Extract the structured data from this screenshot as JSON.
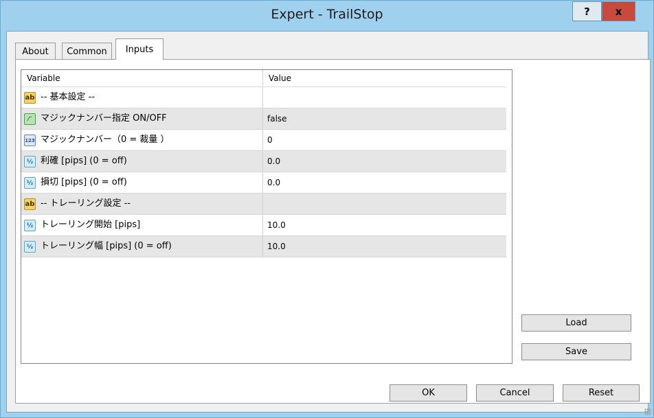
{
  "window": {
    "title": "Expert - TrailStop"
  },
  "titlebar_buttons": {
    "help": "?",
    "close": "x"
  },
  "tabs": [
    {
      "label": "About",
      "active": false
    },
    {
      "label": "Common",
      "active": false
    },
    {
      "label": "Inputs",
      "active": true
    }
  ],
  "grid": {
    "columns": [
      "Variable",
      "Value"
    ],
    "rows": [
      {
        "icon": "string-type-icon",
        "icon_text": "ab",
        "name": "-- 基本設定 --",
        "value": ""
      },
      {
        "icon": "bool-type-icon",
        "icon_text": "⁄‾",
        "name": "マジックナンバー指定 ON/OFF",
        "value": "false"
      },
      {
        "icon": "int-type-icon",
        "icon_text": "123",
        "name": "マジックナンバー（0 = 裁量 ）",
        "value": "0"
      },
      {
        "icon": "double-type-icon",
        "icon_text": "½",
        "name": "利確 [pips] (0 = off)",
        "value": "0.0"
      },
      {
        "icon": "double-type-icon",
        "icon_text": "½",
        "name": "損切 [pips] (0 = off)",
        "value": "0.0"
      },
      {
        "icon": "string-type-icon",
        "icon_text": "ab",
        "name": "-- トレーリング設定 --",
        "value": ""
      },
      {
        "icon": "double-type-icon",
        "icon_text": "½",
        "name": "トレーリング開始 [pips]",
        "value": "10.0"
      },
      {
        "icon": "double-type-icon",
        "icon_text": "½",
        "name": "トレーリング幅 [pips] (0 = off)",
        "value": "10.0"
      }
    ]
  },
  "side_buttons": {
    "load": "Load",
    "save": "Save"
  },
  "footer_buttons": {
    "ok": "OK",
    "cancel": "Cancel",
    "reset": "Reset"
  }
}
